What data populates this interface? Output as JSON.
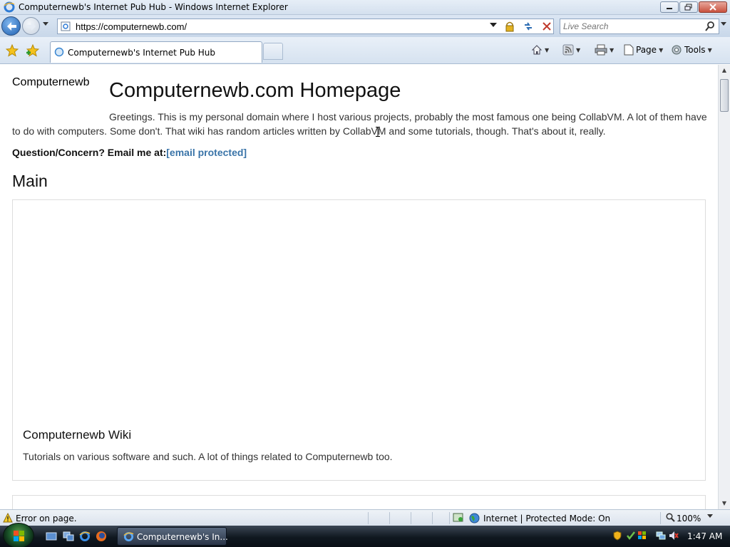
{
  "window": {
    "title": "Computernewb's Internet Pub Hub - Windows Internet Explorer"
  },
  "address_bar": {
    "url": "https://computernewb.com/"
  },
  "search": {
    "placeholder": "Live Search"
  },
  "tabs": [
    {
      "label": "Computernewb's Internet Pub Hub"
    }
  ],
  "command_bar": {
    "page_label": "Page",
    "tools_label": "Tools"
  },
  "page": {
    "site_name": "Computernewb",
    "title": "Computernewb.com Homepage",
    "intro": "Greetings. This is my personal domain where I host various projects, probably the most famous one being CollabVM. A lot of them have to do with computers. Some don't. That wiki has random articles written by CollabVM and some tutorials, though. That's about it, really.",
    "email_prefix": "Question/Concern? Email me at:",
    "email_link": "[email protected]",
    "section_heading": "Main",
    "cards": [
      {
        "title": "Computernewb Wiki",
        "description": "Tutorials on various software and such. A lot of things related to Computernewb too."
      }
    ]
  },
  "status_bar": {
    "message": "Error on page.",
    "zone": "Internet | Protected Mode: On",
    "zoom": "100%"
  },
  "taskbar": {
    "active_window": "Computernewb's In...",
    "clock": "1:47 AM"
  },
  "colors": {
    "link": "#3a74a8",
    "ie_blue": "#1e5fb0"
  }
}
